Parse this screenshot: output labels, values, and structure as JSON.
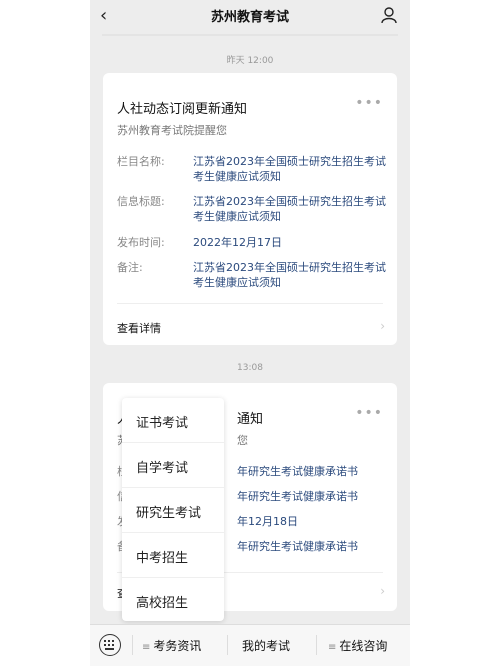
{
  "header": {
    "title": "苏州教育考试",
    "back_icon": "‹"
  },
  "messages": [
    {
      "time": "昨天 12:00",
      "title": "人社动态订阅更新通知",
      "subtitle": "苏州教育考试院提醒您",
      "fields": [
        {
          "label": "栏目名称:",
          "value": "江苏省2023年全国硕士研究生招生考试考生健康应试须知"
        },
        {
          "label": "信息标题:",
          "value": "江苏省2023年全国硕士研究生招生考试考生健康应试须知"
        },
        {
          "label": "发布时间:",
          "value": "2022年12月17日"
        },
        {
          "label": "备注:",
          "value": "江苏省2023年全国硕士研究生招生考试考生健康应试须知"
        }
      ],
      "more": "查看详情"
    },
    {
      "time": "13:08",
      "title_tail": "通知",
      "subtitle_tail": "您",
      "fields": [
        {
          "label_head": "栏",
          "value_tail": "年研究生考试健康承诺书"
        },
        {
          "label_head": "信",
          "value_tail": "年研究生考试健康承诺书"
        },
        {
          "label_head": "发",
          "value_tail": "年12月18日"
        },
        {
          "label_head": "备",
          "value_tail": "年研究生考试健康承诺书"
        }
      ],
      "more_head": "查",
      "title_head": "人",
      "subtitle_head": "苏"
    }
  ],
  "popup_menu": [
    "证书考试",
    "自学考试",
    "研究生考试",
    "中考招生",
    "高校招生"
  ],
  "bottom_bar": {
    "tabs": [
      "考务资讯",
      "我的考试",
      "在线咨询"
    ]
  },
  "colors": {
    "link": "#2b4a7d",
    "background": "#ededed"
  }
}
